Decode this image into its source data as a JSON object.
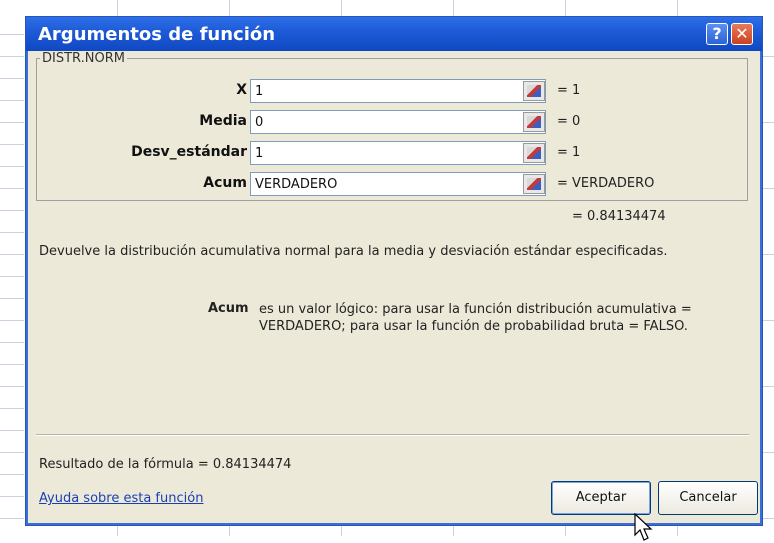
{
  "dialog": {
    "title": "Argumentos de función",
    "help_glyph": "?",
    "close_glyph": "✕"
  },
  "function_name": "DISTR.NORM",
  "args": [
    {
      "label": "X",
      "value": "1",
      "result": "= 1"
    },
    {
      "label": "Media",
      "value": "0",
      "result": "= 0"
    },
    {
      "label": "Desv_estándar",
      "value": "1",
      "result": "= 1"
    },
    {
      "label": "Acum",
      "value": "VERDADERO",
      "result": "= VERDADERO"
    }
  ],
  "function_result": "= 0.84134474",
  "description": "Devuelve la distribución acumulativa normal para la media y desviación estándar especificadas.",
  "current_arg": {
    "name": "Acum",
    "description": "es un valor lógico: para usar la función distribución acumulativa = VERDADERO; para usar la función de probabilidad bruta = FALSO."
  },
  "formula_result": "Resultado de la fórmula =  0.84134474",
  "help_link": "Ayuda sobre esta función",
  "buttons": {
    "ok": "Aceptar",
    "cancel": "Cancelar"
  },
  "colors": {
    "title_bar": "#1f5bd8",
    "dialog_bg": "#ece9d8",
    "link": "#1a3fb5"
  }
}
